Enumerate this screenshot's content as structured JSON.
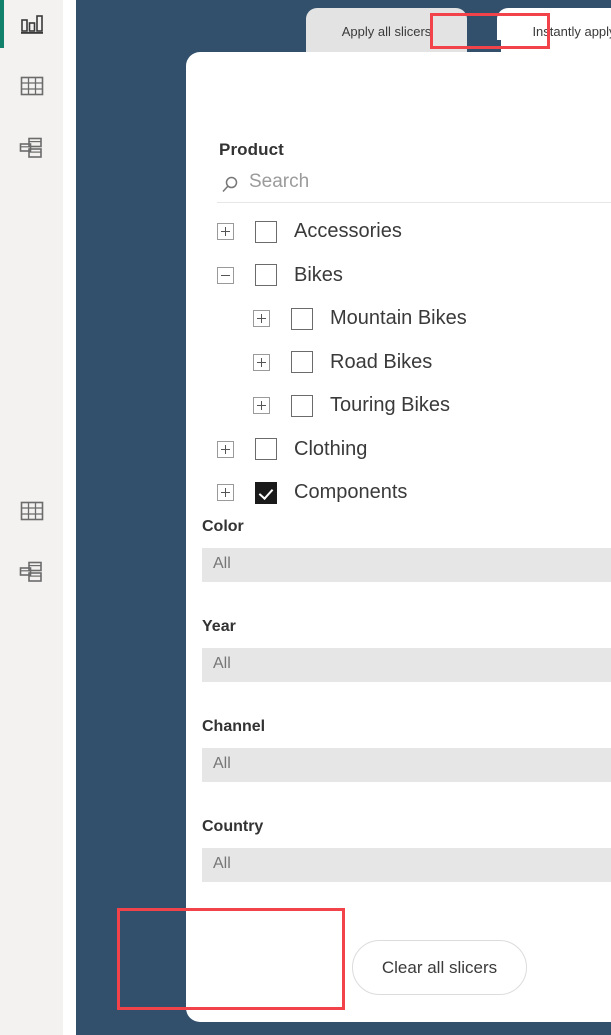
{
  "app": {
    "canvas_bg": "#32506b",
    "rail_bg": "#f3f2f1",
    "accent_color": "#11816b",
    "highlight_color": "#f3434a"
  },
  "rail": {
    "items": [
      {
        "name": "report-view",
        "icon": "bar-chart-icon",
        "selected": true
      },
      {
        "name": "data-view",
        "icon": "table-icon",
        "selected": false
      },
      {
        "name": "model-view",
        "icon": "relationships-icon",
        "selected": false
      },
      {
        "name": "data-view-secondary",
        "icon": "table-icon",
        "selected": false
      },
      {
        "name": "model-view-secondary",
        "icon": "relationships-icon",
        "selected": false
      }
    ]
  },
  "tabs": [
    {
      "label": "Apply all slicers",
      "active": false
    },
    {
      "label": "Instantly apply",
      "active": true
    }
  ],
  "product_slicer": {
    "title": "Product",
    "collapse_icon": "chevron-down-icon",
    "search": {
      "icon": "search-icon",
      "placeholder": "Search",
      "value": ""
    },
    "tree": [
      {
        "label": "Accessories",
        "level": 0,
        "expander": "plus",
        "checked": false
      },
      {
        "label": "Bikes",
        "level": 0,
        "expander": "minus",
        "checked": false
      },
      {
        "label": "Mountain Bikes",
        "level": 1,
        "expander": "plus",
        "checked": false
      },
      {
        "label": "Road Bikes",
        "level": 1,
        "expander": "plus",
        "checked": false
      },
      {
        "label": "Touring Bikes",
        "level": 1,
        "expander": "plus",
        "checked": false
      },
      {
        "label": "Clothing",
        "level": 0,
        "expander": "plus",
        "checked": false
      },
      {
        "label": "Components",
        "level": 0,
        "expander": "plus",
        "checked": true
      }
    ]
  },
  "dropdown_slicers": [
    {
      "title": "Color",
      "value": "All",
      "collapse_icon": "chevron-down-icon",
      "open_icon": "chevron-down-icon"
    },
    {
      "title": "Year",
      "value": "All",
      "collapse_icon": "chevron-down-icon",
      "open_icon": "chevron-down-icon"
    },
    {
      "title": "Channel",
      "value": "All",
      "collapse_icon": "chevron-down-icon",
      "open_icon": "chevron-down-icon"
    },
    {
      "title": "Country",
      "value": "All",
      "collapse_icon": "chevron-down-icon",
      "open_icon": "chevron-down-icon"
    }
  ],
  "footer": {
    "clear_button_label": "Clear all slicers"
  },
  "annotations": [
    {
      "name": "tab-highlight",
      "target": "Instantly apply"
    },
    {
      "name": "footer-area-highlight",
      "target": "apply-button-area"
    }
  ]
}
